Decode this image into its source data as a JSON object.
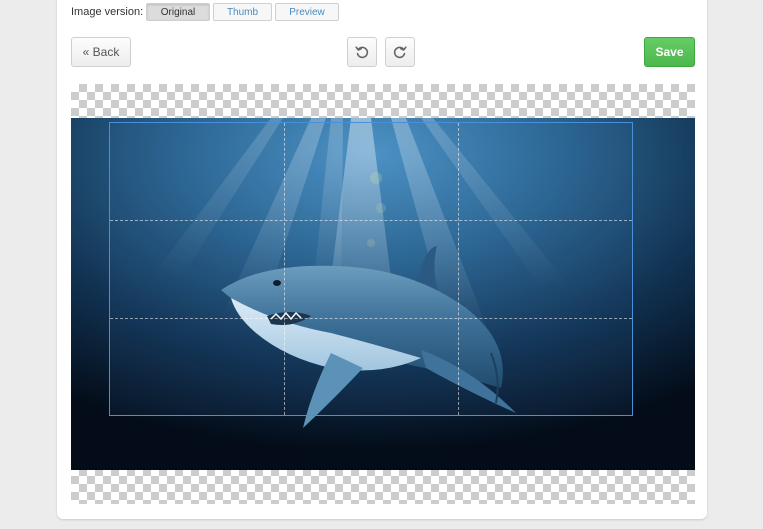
{
  "toolbar": {
    "version_label": "Image version:",
    "versions": [
      {
        "label": "Original",
        "active": true
      },
      {
        "label": "Thumb",
        "active": false
      },
      {
        "label": "Preview",
        "active": false
      }
    ],
    "back_label": "« Back",
    "rotate_left_icon": "rotate-ccw-icon",
    "rotate_right_icon": "rotate-cw-icon",
    "save_label": "Save"
  },
  "colors": {
    "save_green": "#5cb85c",
    "crop_border": "#4a90d9",
    "link_blue": "#4a8ac0"
  },
  "editor": {
    "image_subject": "shark underwater",
    "crop_grid": "rule-of-thirds"
  }
}
